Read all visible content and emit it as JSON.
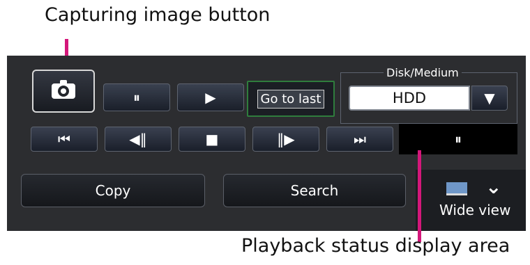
{
  "callouts": {
    "top": "Capturing image button",
    "bottom": "Playback status display area"
  },
  "controls": {
    "pause_glyph": "⏸",
    "play_glyph": "▶",
    "goto_last_label": "Go to last",
    "skip_prev_glyph": "⏮",
    "step_back_glyph": "◀‖",
    "stop_glyph": "■",
    "step_forward_glyph": "‖▶",
    "skip_next_glyph": "⏭"
  },
  "disk_medium": {
    "legend": "Disk/Medium",
    "value": "HDD",
    "dropdown_glyph": "▼"
  },
  "playback_status": {
    "glyph": "⏸"
  },
  "buttons": {
    "copy": "Copy",
    "search": "Search",
    "wide_view": "Wide view",
    "wide_chevron": "⌄"
  },
  "colors": {
    "pointer": "#d4177a",
    "panel": "#2c2d30",
    "goto_last_border": "#2f7d3d",
    "wide_icon": "#6f97c8"
  }
}
